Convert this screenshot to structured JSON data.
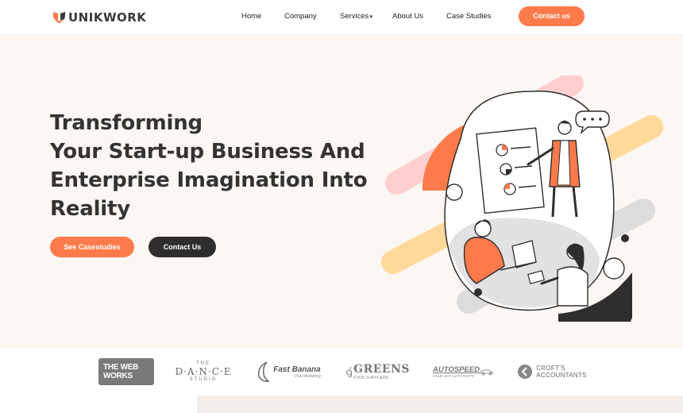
{
  "brand": {
    "name": "UNIKWORK",
    "accent": "#ff7a4a",
    "dark": "#2e2e2e"
  },
  "nav": {
    "items": [
      {
        "label": "Home"
      },
      {
        "label": "Company"
      },
      {
        "label": "Services"
      },
      {
        "label": "About Us"
      },
      {
        "label": "Case Studies"
      }
    ],
    "cta_label": "Contact us"
  },
  "hero": {
    "headline_lines": [
      "Transforming",
      "Your Start-up Business And",
      "Enterprise Imagination Into",
      "Reality"
    ],
    "primary_button": "See Casestudies",
    "secondary_button": "Contact Us"
  },
  "clients": {
    "webworks": "THE WEB WORKS",
    "dance_main": "D·A·N·C·E",
    "dance_sub": "STUDIO",
    "dance_top": "THE",
    "fastbanana": "Fast Banana",
    "fastbanana_sub": "Viral Marketing",
    "greens": "GREENS",
    "greens_sub": "FOOD SUPPLIERS",
    "autospeed": "AUTOSPEED",
    "autospeed_sub": "SAME DAY AUTO PARTS",
    "crofts_1": "CROFT'S",
    "crofts_2": "ACCOUNTANTS"
  }
}
